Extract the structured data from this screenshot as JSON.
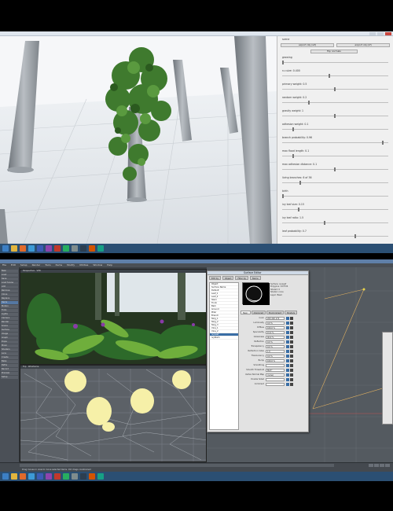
{
  "top_window": {
    "title": "",
    "panel": {
      "section_label": "scene",
      "button_export": "export obj (wf)",
      "button_export2": "export obj (xf)",
      "button_flip": "flip normals",
      "sliders": [
        {
          "label": "growing",
          "value": 0.0
        },
        {
          "label": "n-r-size: 0.400",
          "value": 0.45
        },
        {
          "label": "primary weight: 0.5",
          "value": 0.5
        },
        {
          "label": "random weight: 0.2",
          "value": 0.25
        },
        {
          "label": "gravity weight: 1",
          "value": 0.5
        },
        {
          "label": "adhesion weight: 0.1",
          "value": 0.1
        },
        {
          "label": "branch probability: 0.96",
          "value": 0.96
        },
        {
          "label": "max flood length: 0.1",
          "value": 0.1
        },
        {
          "label": "max adhesion distance: 0.1",
          "value": 0.5
        },
        {
          "label": "living branches: 6 of 36",
          "value": 0.17
        },
        {
          "label": "birth",
          "value": 0.0
        },
        {
          "label": "ivy leaf size: 0.15",
          "value": 0.15
        },
        {
          "label": "ivy leaf ratio: 1.5",
          "value": 0.4
        },
        {
          "label": "leaf probability: 0.7",
          "value": 0.7
        }
      ],
      "grow_button": "grow",
      "birth_button": "birth"
    }
  },
  "bottom_window": {
    "title": "",
    "menu": [
      "File",
      "Edit",
      "Setup",
      "Render",
      "Tools",
      "Items",
      "Modify",
      "Utilities",
      "Window",
      "Help"
    ],
    "left_toolbar": [
      "New",
      "Load",
      "Save",
      "Load Scene",
      "Add",
      "Remove",
      "Clone",
      "Replace",
      "Items",
      "Motion",
      "Tools",
      "Lights",
      "Camera",
      "Render",
      "Scene",
      "Surface",
      "Image",
      "Graph",
      "Dope",
      "Mixer",
      "Shaders",
      "Lens",
      "Create",
      "Bake",
      "Paths",
      "Record",
      "Preview",
      "Setup"
    ],
    "viewport_titles": {
      "render": "Perspective · VPR",
      "wire": "Top · Wireframe"
    },
    "surface_editor": {
      "title": "Surface Editor",
      "toolbar": [
        "Edit by",
        "Object",
        "Filter by",
        "Name"
      ],
      "surfaces": [
        "Object",
        "Surface Name",
        "Default",
        "Leaf_1",
        "Leaf_2",
        "Stem",
        "Trunk",
        "Bark",
        "Ground",
        "Pillar",
        "Branch",
        "Twig_1",
        "Twig_2",
        "Twig_3",
        "Vine_1",
        "Vine_2",
        "ivyLeaf",
        "ivyStem"
      ],
      "selected_index": 16,
      "info": [
        "Surface: ivyLeaf",
        "Polygons: 127534",
        "Shared: 0",
        "Shader: none",
        "Layer: Basic"
      ],
      "tabs": [
        "Basic",
        "Advanced",
        "Environment",
        "Shaders"
      ],
      "params": [
        {
          "label": "Color",
          "value": "200 220 170"
        },
        {
          "label": "Luminosity",
          "value": "0.0 %"
        },
        {
          "label": "Diffuse",
          "value": "100.0 %"
        },
        {
          "label": "Specularity",
          "value": "15.0 %"
        },
        {
          "label": "Glossiness",
          "value": "40.0 %"
        },
        {
          "label": "Reflection",
          "value": "0.0 %"
        },
        {
          "label": "Transparency",
          "value": "0.0 %"
        },
        {
          "label": "Refraction Index",
          "value": "1.0"
        },
        {
          "label": "Translucency",
          "value": "0.0 %"
        },
        {
          "label": "Bump",
          "value": "100.0 %"
        },
        {
          "label": "Smoothing",
          "value": ""
        },
        {
          "label": "Smooth Threshold",
          "value": "89.5°"
        },
        {
          "label": "Vertex Normal Map",
          "value": "(none)"
        },
        {
          "label": "Double Sided",
          "value": ""
        },
        {
          "label": "Comment",
          "value": ""
        }
      ]
    },
    "status_text": "Drag mouse in view to move selected items. Ctrl drags constrained"
  },
  "taskbar": {
    "icons": [
      {
        "name": "explorer-icon",
        "color": "#e2b53e"
      },
      {
        "name": "media-icon",
        "color": "#e06a2b"
      },
      {
        "name": "app-icon-1",
        "color": "#3c9ad6"
      },
      {
        "name": "app-icon-2",
        "color": "#3b5bb5"
      },
      {
        "name": "app-icon-3",
        "color": "#8e44ad"
      },
      {
        "name": "app-icon-4",
        "color": "#c0392b"
      },
      {
        "name": "app-icon-5",
        "color": "#27ae60"
      },
      {
        "name": "app-icon-6",
        "color": "#7f8c8d"
      },
      {
        "name": "app-icon-7",
        "color": "#2c3e50"
      },
      {
        "name": "app-icon-8",
        "color": "#d35400"
      },
      {
        "name": "app-icon-9",
        "color": "#16a085"
      }
    ]
  },
  "colors": {
    "top_bg": "#e9ecef",
    "taskbar": "#2b4f73",
    "lw_bg": "#3a3f44",
    "leaf_green": "#3f7a2e"
  }
}
